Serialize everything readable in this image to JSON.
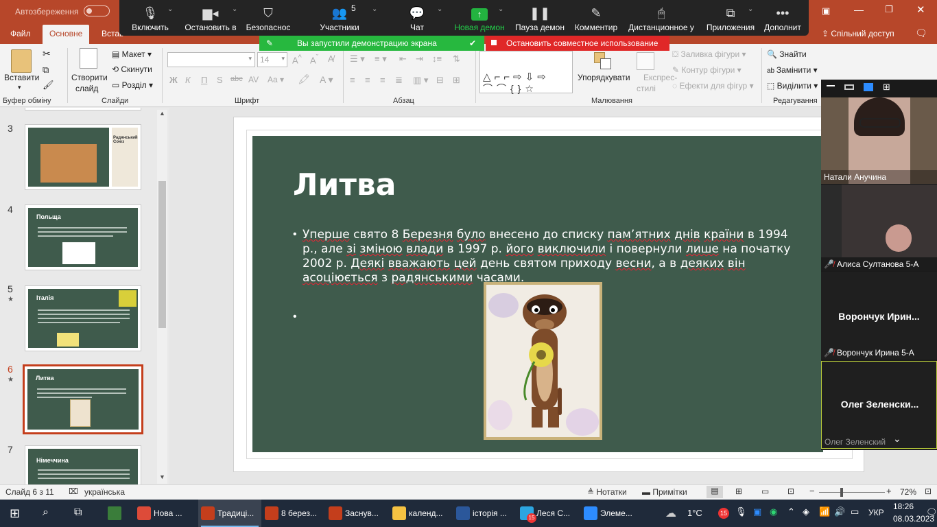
{
  "titlebar": {
    "autosave_label": "Автозбереження",
    "autosave_state": "off"
  },
  "ribbon_tabs": [
    "Файл",
    "Основне",
    "Встав"
  ],
  "share_button": "Спільний доступ",
  "zoom_toolbar": {
    "buttons": [
      {
        "label": "Включить",
        "icon": "microphone-icon"
      },
      {
        "label": "Остановить в",
        "icon": "camera-icon"
      },
      {
        "label": "Безопаснос",
        "icon": "shield-icon"
      },
      {
        "label": "Участники",
        "icon": "participants-icon",
        "count": "5"
      },
      {
        "label": "Чат",
        "icon": "chat-icon"
      },
      {
        "label": "Новая демон",
        "icon": "share-screen-icon"
      },
      {
        "label": "Пауза демон",
        "icon": "pause-icon"
      },
      {
        "label": "Комментир",
        "icon": "pen-icon"
      },
      {
        "label": "Дистанционное у",
        "icon": "mouse-icon"
      },
      {
        "label": "Приложения",
        "icon": "apps-icon"
      },
      {
        "label": "Дополнит",
        "icon": "more-icon"
      }
    ],
    "sharing_banner": "Вы запустили демонстрацию экрана",
    "stop_banner": "Остановить совместное использование"
  },
  "ribbon": {
    "clipboard": {
      "paste": "Вставити",
      "label": "Буфер обміну"
    },
    "slides": {
      "new_slide_line1": "Створити",
      "new_slide_line2": "слайд",
      "layout": "Макет",
      "reset": "Скинути",
      "section": "Розділ",
      "label": "Слайди"
    },
    "font": {
      "font_name": "",
      "font_size": "14",
      "bold": "Ж",
      "italic": "К",
      "underline": "П",
      "label": "Шрифт"
    },
    "paragraph": {
      "label": "Абзац"
    },
    "drawing": {
      "arrange": "Упорядкувати",
      "quick_styles_line1": "Експрес-",
      "quick_styles_line2": "стилі",
      "shape_fill": "Заливка фігури",
      "shape_outline": "Контур фігури",
      "shape_effects": "Ефекти для фігур",
      "label": "Малювання"
    },
    "editing": {
      "find": "Знайти",
      "replace": "Замінити",
      "select": "Виділити",
      "label": "Редагування"
    }
  },
  "thumbnails": [
    {
      "num": "3",
      "title": "Радянський Союз",
      "star": false
    },
    {
      "num": "4",
      "title": "Польща",
      "star": false
    },
    {
      "num": "5",
      "title": "Італія",
      "star": true
    },
    {
      "num": "6",
      "title": "Литва",
      "star": true,
      "selected": true
    },
    {
      "num": "7",
      "title": "Німеччина",
      "star": false
    }
  ],
  "slide": {
    "title": "Литва",
    "body_words": [
      {
        "t": "Уперше",
        "sq": true
      },
      {
        "t": " свято 8 ",
        "sq": false
      },
      {
        "t": "Березня",
        "sq": true
      },
      {
        "t": " ",
        "sq": false
      },
      {
        "t": "було",
        "sq": true
      },
      {
        "t": " внесено до списку ",
        "sq": false
      },
      {
        "t": "пам’ятних",
        "sq": true
      },
      {
        "t": " ",
        "sq": false
      },
      {
        "t": "днів",
        "sq": true
      },
      {
        "t": " ",
        "sq": false
      },
      {
        "t": "країни",
        "sq": true
      },
      {
        "t": " в 1994 р., але ",
        "sq": false
      },
      {
        "t": "зі",
        "sq": true
      },
      {
        "t": " ",
        "sq": false
      },
      {
        "t": "зміною",
        "sq": true
      },
      {
        "t": " ",
        "sq": false
      },
      {
        "t": "влади",
        "sq": true
      },
      {
        "t": " в 1997 р. ",
        "sq": false
      },
      {
        "t": "його",
        "sq": true
      },
      {
        "t": " ",
        "sq": false
      },
      {
        "t": "виключили",
        "sq": true
      },
      {
        "t": " і повернули ",
        "sq": false
      },
      {
        "t": "лише",
        "sq": true
      },
      {
        "t": " на початку 2002 р. ",
        "sq": false
      },
      {
        "t": "Деякі",
        "sq": true
      },
      {
        "t": " ",
        "sq": false
      },
      {
        "t": "вважають",
        "sq": true
      },
      {
        "t": " ",
        "sq": false
      },
      {
        "t": "цей",
        "sq": true
      },
      {
        "t": " день святом приходу ",
        "sq": false
      },
      {
        "t": "весни",
        "sq": true
      },
      {
        "t": ", а в ",
        "sq": false
      },
      {
        "t": "деяких",
        "sq": true
      },
      {
        "t": " ",
        "sq": false
      },
      {
        "t": "він",
        "sq": true
      },
      {
        "t": " ",
        "sq": false
      },
      {
        "t": "асоціюється",
        "sq": true
      },
      {
        "t": " з ",
        "sq": false
      },
      {
        "t": "радянськими",
        "sq": true
      },
      {
        "t": " часами.",
        "sq": false
      }
    ]
  },
  "video_panel": {
    "participants": [
      {
        "name": "Натали Анучина",
        "muted": false,
        "video": true
      },
      {
        "name": "Алиса Султанова 5-А",
        "muted": true,
        "video": true
      },
      {
        "big_name": "Ворончук  Ирин...",
        "name": "Ворончук Ирина 5-А",
        "muted": true,
        "video": false
      },
      {
        "big_name": "Олег  Зеленски...",
        "name": "Олег Зеленский",
        "muted": false,
        "video": false
      }
    ]
  },
  "status_bar": {
    "slide_info": "Слайд 6 з 11",
    "language": "українська",
    "notes": "Нотатки",
    "comments": "Примітки",
    "zoom": "72%",
    "zoom_level": 0.72
  },
  "taskbar": {
    "apps": [
      {
        "label": "Нова ...",
        "icon": "chrome-icon",
        "color": "#dd4b39"
      },
      {
        "label": "Традиці...",
        "icon": "powerpoint-icon",
        "color": "#c43e1c",
        "active": true
      },
      {
        "label": "8 берез...",
        "icon": "powerpoint-icon",
        "color": "#c43e1c"
      },
      {
        "label": "Заснув...",
        "icon": "powerpoint-icon",
        "color": "#c43e1c"
      },
      {
        "label": "календ...",
        "icon": "folder-icon",
        "color": "#f5c242"
      },
      {
        "label": "історія ...",
        "icon": "word-icon",
        "color": "#2b579a"
      },
      {
        "label": "Леся С...",
        "icon": "telegram-icon",
        "color": "#2ca5e0",
        "badge": "15"
      },
      {
        "label": "Элеме...",
        "icon": "zoom-icon",
        "color": "#2d8cff"
      }
    ],
    "temperature": "1°C",
    "notif_badge": "15",
    "lang": "УКР",
    "time": "18:26",
    "date": "08.03.2023"
  }
}
